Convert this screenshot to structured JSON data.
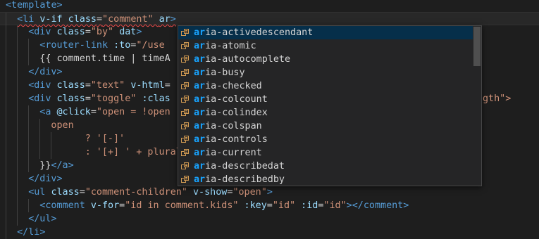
{
  "editor": {
    "lines": [
      [
        [
          "tag",
          "<template>"
        ]
      ],
      [
        [
          "tag",
          "<li "
        ],
        [
          "attr",
          "v-if "
        ],
        [
          "attr",
          "class"
        ],
        [
          "txt",
          "="
        ],
        [
          "str",
          "\"comment\" "
        ],
        [
          "attr",
          "ar"
        ],
        [
          "tag",
          ">"
        ]
      ],
      [
        [
          "tag",
          "<div "
        ],
        [
          "attr",
          "class"
        ],
        [
          "txt",
          "="
        ],
        [
          "str",
          "\"by\" "
        ],
        [
          "attr",
          "dat"
        ],
        [
          "tag",
          ">"
        ]
      ],
      [
        [
          "tag",
          "<router-link "
        ],
        [
          "attr",
          ":to"
        ],
        [
          "txt",
          "="
        ],
        [
          "str",
          "\"/use"
        ]
      ],
      [
        [
          "txt",
          "{{ comment.time | timeA"
        ]
      ],
      [
        [
          "tag",
          "</div>"
        ]
      ],
      [
        [
          "tag",
          "<div "
        ],
        [
          "attr",
          "class"
        ],
        [
          "txt",
          "="
        ],
        [
          "str",
          "\"text\" "
        ],
        [
          "attr",
          "v-html"
        ],
        [
          "txt",
          "="
        ]
      ],
      [
        [
          "tag",
          "<div "
        ],
        [
          "attr",
          "class"
        ],
        [
          "txt",
          "="
        ],
        [
          "str",
          "\"toggle\" "
        ],
        [
          "attr",
          ":clas"
        ]
      ],
      [
        [
          "tag",
          "<a "
        ],
        [
          "attr",
          "@click"
        ],
        [
          "txt",
          "="
        ],
        [
          "str",
          "\"open = !open"
        ]
      ],
      [
        [
          "str",
          "open"
        ]
      ],
      [
        [
          "str",
          "? '[-]'"
        ]
      ],
      [
        [
          "str",
          ": '[+] ' + plural"
        ]
      ],
      [
        [
          "txt",
          "}}"
        ],
        [
          "tag",
          "</a>"
        ]
      ],
      [
        [
          "tag",
          "</div>"
        ]
      ],
      [
        [
          "tag",
          "<ul "
        ],
        [
          "attr",
          "class"
        ],
        [
          "txt",
          "="
        ],
        [
          "str",
          "\"comment-children\" "
        ],
        [
          "attr",
          "v-show"
        ],
        [
          "txt",
          "="
        ],
        [
          "str",
          "\"open\""
        ],
        [
          "tag",
          ">"
        ]
      ],
      [
        [
          "tag",
          "<comment "
        ],
        [
          "attr",
          "v-for"
        ],
        [
          "txt",
          "="
        ],
        [
          "str",
          "\"id in comment.kids\" "
        ],
        [
          "attr",
          ":key"
        ],
        [
          "txt",
          "="
        ],
        [
          "str",
          "\"id\" "
        ],
        [
          "attr",
          ":id"
        ],
        [
          "txt",
          "="
        ],
        [
          "str",
          "\"id\""
        ],
        [
          "tag",
          "></comment>"
        ]
      ],
      [
        [
          "tag",
          "</ul>"
        ]
      ],
      [
        [
          "tag",
          "</li>"
        ]
      ]
    ],
    "line7_tail": "gth\">"
  },
  "suggest": {
    "typed": "ar",
    "items": [
      "aria-activedescendant",
      "aria-atomic",
      "aria-autocomplete",
      "aria-busy",
      "aria-checked",
      "aria-colcount",
      "aria-colindex",
      "aria-colspan",
      "aria-controls",
      "aria-current",
      "aria-describedat",
      "aria-describedby"
    ],
    "selected_index": 0,
    "item_icon": "property-icon",
    "colors": {
      "match": "#18a3ff",
      "selected_bg": "#062f4a"
    }
  }
}
